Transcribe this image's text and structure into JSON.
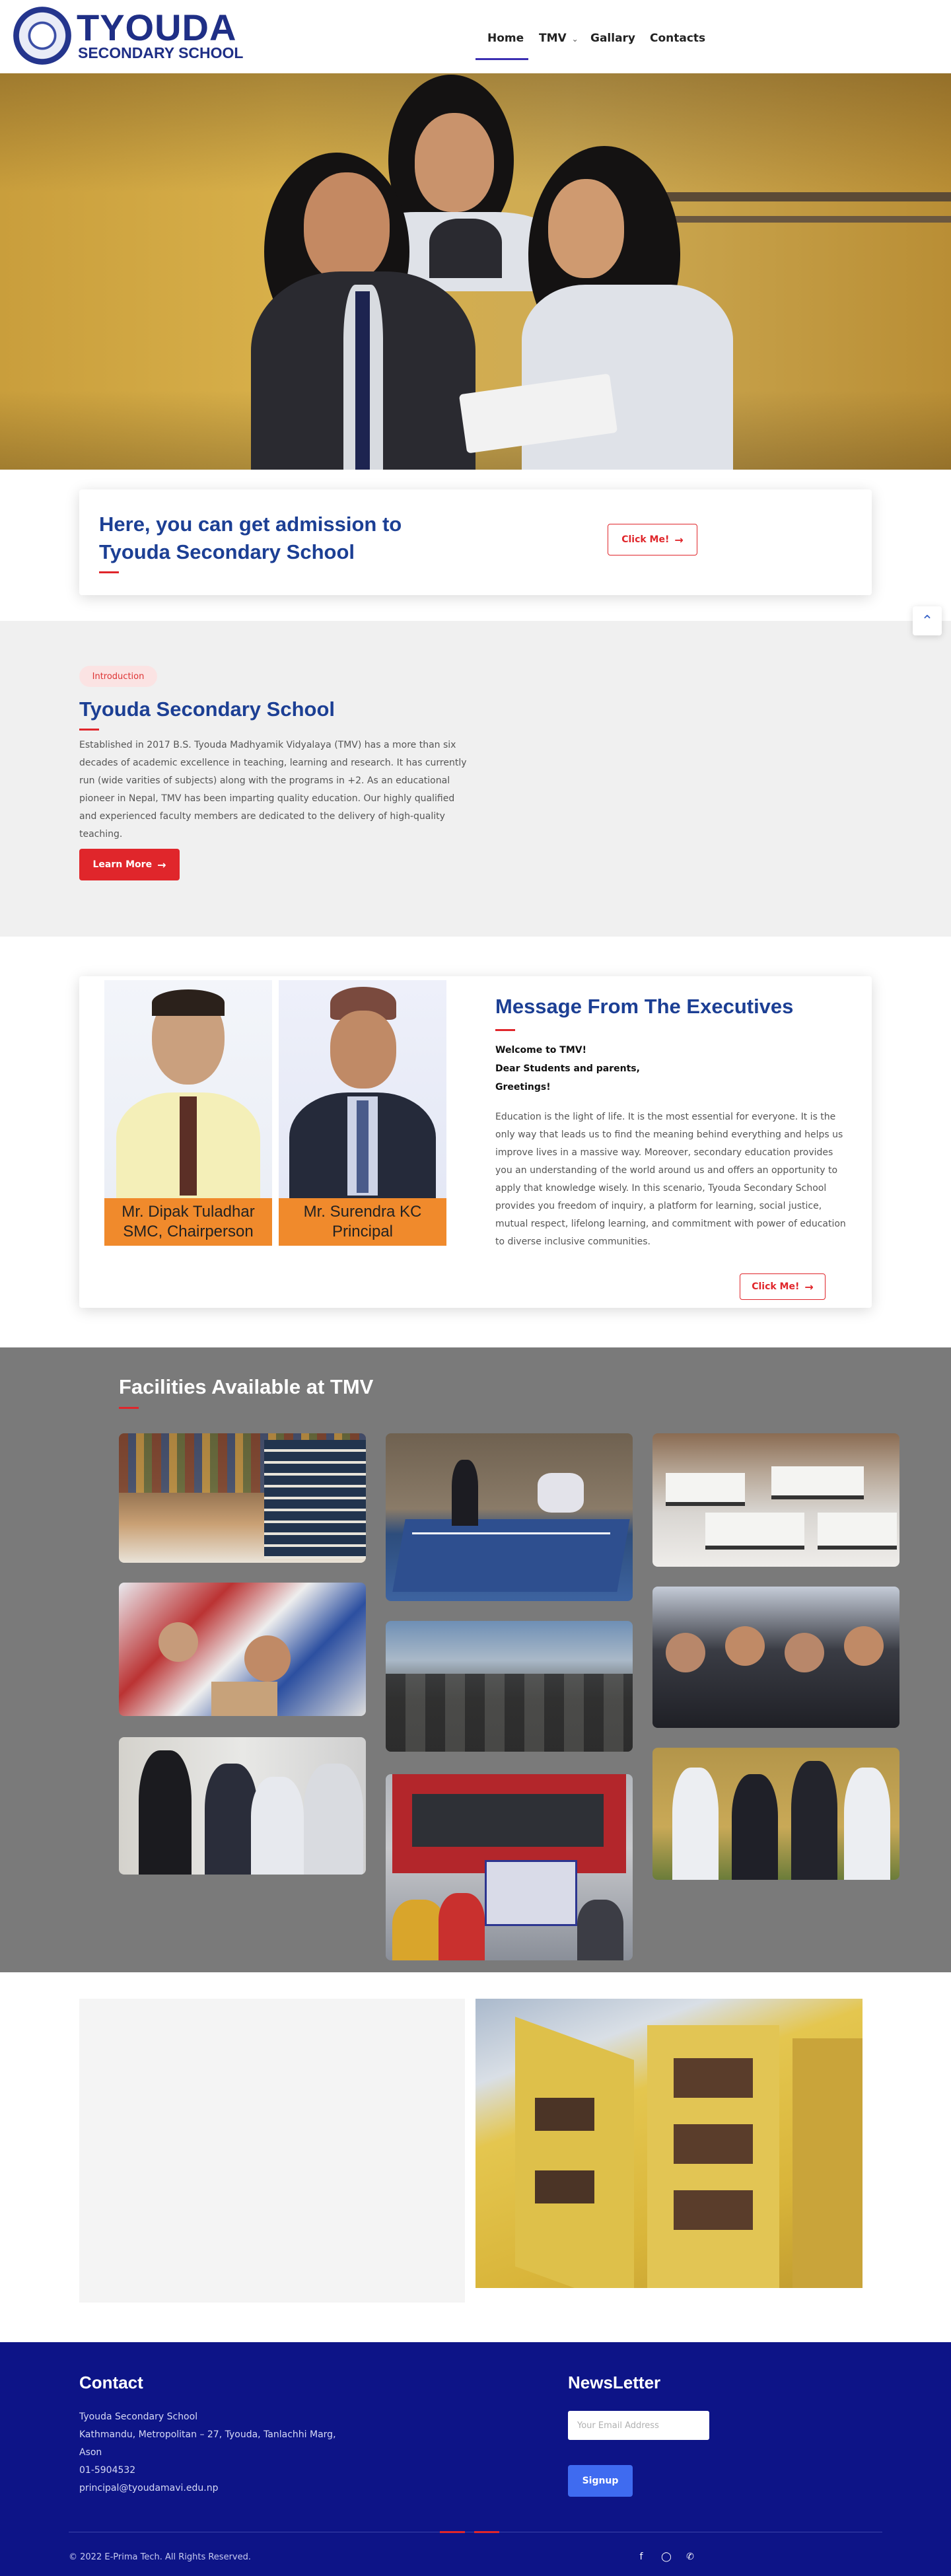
{
  "header": {
    "logo_title": "TYOUDA",
    "logo_subtitle": "SECONDARY SCHOOL",
    "nav": [
      {
        "label": "Home",
        "active": true
      },
      {
        "label": "TMV",
        "has_dropdown": true
      },
      {
        "label": "Gallary"
      },
      {
        "label": "Contacts"
      }
    ]
  },
  "admission": {
    "heading": "Here, you can get admission to Tyouda Secondary School",
    "button_label": "Click Me!"
  },
  "intro": {
    "tag": "Introduction",
    "heading": "Tyouda Secondary School",
    "body": "Established in 2017 B.S. Tyouda Madhyamik Vidyalaya (TMV) has a more than six decades of academic excellence in teaching, learning and research. It has currently run (wide varities of subjects) along with the programs in +2. As an educational pioneer in Nepal, TMV has been imparting quality education. Our highly qualified and experienced faculty members are dedicated to the delivery of high-quality teaching.",
    "button_label": "Learn More"
  },
  "executives": {
    "heading": "Message From The Executives",
    "people": [
      {
        "name": "Mr. Dipak Tuladhar",
        "role": "SMC, Chairperson"
      },
      {
        "name": "Mr. Surendra KC",
        "role": "Principal"
      }
    ],
    "greeting_1": "Welcome to TMV!",
    "greeting_2": "Dear Students and parents,",
    "greeting_3": "Greetings!",
    "body": "Education is the light of life. It is the most essential for everyone. It is the only way that leads us to find the meaning behind everything and helps us improve lives in a massive way. Moreover, secondary education provides you an understanding of the world around us and offers an opportunity to apply that knowledge wisely. In this scenario, Tyouda Secondary School provides you freedom of inquiry, a platform for learning, social justice, mutual respect, lifelong learning, and commitment with power of education to diverse inclusive communities.",
    "button_label": "Click Me!"
  },
  "facilities": {
    "heading": "Facilities Available at TMV"
  },
  "footer": {
    "contact_heading": "Contact",
    "address_lines": [
      "Tyouda Secondary School",
      "Kathmandu, Metropolitan – 27, Tyouda, Tanlachhi Marg,",
      "Ason",
      "01-5904532",
      "principal@tyoudamavi.edu.np"
    ],
    "newsletter_heading": "NewsLetter",
    "email_placeholder": "Your Email Address",
    "signup_label": "Signup",
    "copyright": "© 2022 E-Prima Tech. All Rights Reserved.",
    "social_icons": [
      "facebook-icon",
      "instagram-icon",
      "whatsapp-icon"
    ]
  },
  "colors": {
    "brand_blue": "#1c3f94",
    "accent_red": "#e0262b",
    "footer_bg": "#0d1487",
    "facilities_bg": "#7a7a7a"
  }
}
